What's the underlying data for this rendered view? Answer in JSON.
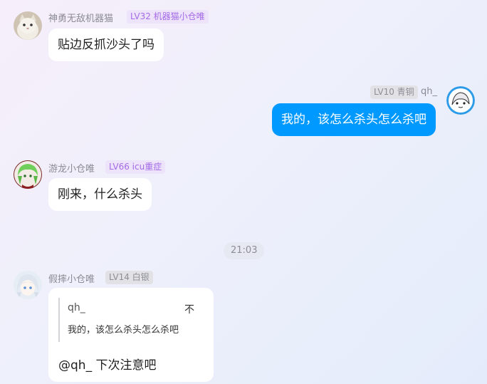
{
  "messages": [
    {
      "sender": "神勇无敌机器猫",
      "badge": "LV32 机器猫小仓唯",
      "text": "贴边反抓沙头了吗",
      "avatar_icon": "cat-avatar-icon"
    },
    {
      "sender": "qh_",
      "badge": "LV10 青铜",
      "text": "我的，该怎么杀头怎么杀吧",
      "avatar_icon": "anime-avatar-icon"
    },
    {
      "sender": "游龙小仓唯",
      "badge": "LV66 icu重症",
      "text": "刚来，什么杀头",
      "avatar_icon": "green-hair-avatar-icon"
    },
    {
      "sender": "假摔小仓唯",
      "badge": "LV14 白银",
      "quote": {
        "author": "qh_",
        "more": "不",
        "text": "我的，该怎么杀头怎么杀吧"
      },
      "text": "@qh_ 下次注意吧",
      "avatar_icon": "silver-hair-avatar-icon"
    }
  ],
  "timestamp": "21:03",
  "colors": {
    "outgoing_bubble": "#0099ff",
    "incoming_bubble": "#ffffff",
    "badge_purple_bg": "#ede3fb",
    "badge_purple_text": "#a46be6",
    "badge_gray_bg": "#e2e2e6",
    "badge_gray_text": "#8d8d96"
  }
}
